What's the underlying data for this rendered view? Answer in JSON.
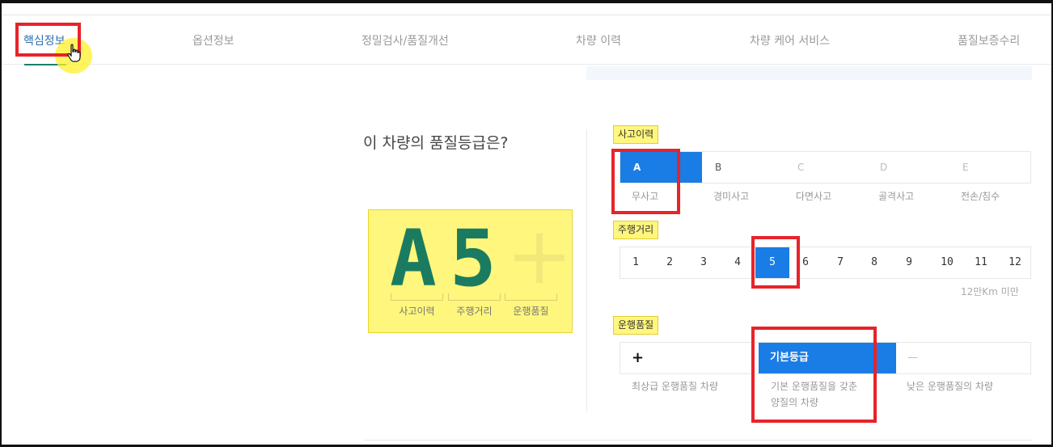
{
  "nav": {
    "tabs": [
      {
        "label": "핵심정보",
        "active": true
      },
      {
        "label": "옵션정보"
      },
      {
        "label": "정밀검사/품질개선"
      },
      {
        "label": "차량 이력"
      },
      {
        "label": "차량 케어 서비스"
      },
      {
        "label": "품질보증수리"
      }
    ]
  },
  "grade": {
    "question": "이 차량의 품질등급은?",
    "letter": "A",
    "number": "5",
    "plus": "+",
    "slots": [
      "사고이력",
      "주행거리",
      "운행품질"
    ]
  },
  "accident": {
    "label": "사고이력",
    "grades": [
      "A",
      "B",
      "C",
      "D",
      "E"
    ],
    "selected": "A",
    "descriptions": [
      "무사고",
      "경미사고",
      "다면사고",
      "골격사고",
      "전손/침수"
    ]
  },
  "mileage": {
    "label": "주행거리",
    "values": [
      "1",
      "2",
      "3",
      "4",
      "5",
      "6",
      "7",
      "8",
      "9",
      "10",
      "11",
      "12"
    ],
    "selected": "5",
    "note": "12만Km 미만"
  },
  "operation": {
    "label": "운행품질",
    "options": [
      "+",
      "기본등급",
      "—"
    ],
    "selected": "기본등급",
    "descriptions": [
      "최상급 운행품질 차량",
      "기본 운행품질을 갖춘 양질의 차량",
      "낮은 운행품질의 차량"
    ]
  },
  "colors": {
    "accent": "#1a7ce5",
    "grade_text": "#1b7b61",
    "highlight": "#fff67d",
    "callout": "#e8232a"
  }
}
